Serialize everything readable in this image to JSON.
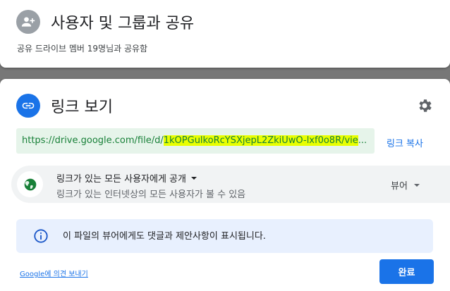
{
  "share_panel": {
    "title": "사용자 및 그룹과 공유",
    "subtitle": "공유 드라이브 멤버 19명님과 공유함",
    "icon": "person-add-icon"
  },
  "link_panel": {
    "title": "링크 보기",
    "icon": "link-icon",
    "settings_icon": "gear-icon",
    "url_prefix": "https://drive.google.com/file/d/",
    "url_highlight": "1kOPGulkoRcYSXjepL2ZkiUwO-lxf0o8R/vie",
    "url_suffix": "...",
    "copy_link_label": "링크 복사",
    "access": {
      "icon": "globe-icon",
      "title": "링크가 있는 모든 사용자에게 공개",
      "description": "링크가 있는 인터넷상의 모든 사용자가 볼 수 있음",
      "role": "뷰어"
    },
    "info": {
      "icon": "info-icon",
      "text": "이 파일의 뷰어에게도 댓글과 제안사항이 표시됩니다."
    },
    "feedback_label": "Google에 의견 보내기",
    "done_label": "완료"
  },
  "colors": {
    "accent": "#1a73e8",
    "url_text": "#188038",
    "url_bg": "#e6f4ea",
    "highlight": "#e8ff00",
    "info_bg": "#e8f0fe",
    "globe": "#188038"
  }
}
